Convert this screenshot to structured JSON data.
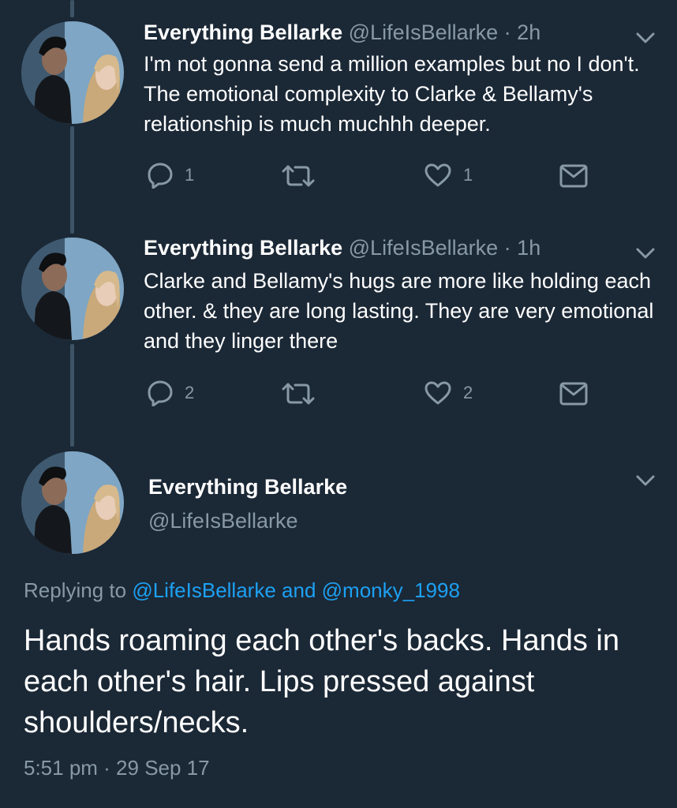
{
  "tweets": [
    {
      "name": "Everything Bellarke",
      "handle": "@LifeIsBellarke",
      "separator": "·",
      "time": "2h",
      "text": "I'm not gonna send a million examples but no I don't. The emotional complexity to Clarke & Bellamy's relationship is much muchhh deeper.",
      "reply_count": "1",
      "like_count": "1"
    },
    {
      "name": "Everything Bellarke",
      "handle": "@LifeIsBellarke",
      "separator": "·",
      "time": "1h",
      "text": "Clarke and Bellamy's hugs are more like holding each other. & they are long lasting. They are very emotional and they linger there",
      "reply_count": "2",
      "like_count": "2"
    }
  ],
  "main_tweet": {
    "name": "Everything Bellarke",
    "handle": "@LifeIsBellarke",
    "replying_prefix": "Replying to",
    "replying_user1": "@LifeIsBellarke",
    "replying_and": "and",
    "replying_user2": "@monky_1998",
    "text": "Hands roaming each other's backs. Hands in each other's hair. Lips pressed against shoulders/necks.",
    "timestamp": "5:51 pm · 29 Sep 17"
  },
  "icons": {
    "reply": "reply-icon",
    "retweet": "retweet-icon",
    "like": "heart-icon",
    "dm": "mail-icon",
    "menu": "chevron-down-icon"
  },
  "colors": {
    "background": "#1b2836",
    "text": "#ffffff",
    "muted": "#8899a6",
    "link": "#1da1f2",
    "thread_line": "#3d5466"
  }
}
